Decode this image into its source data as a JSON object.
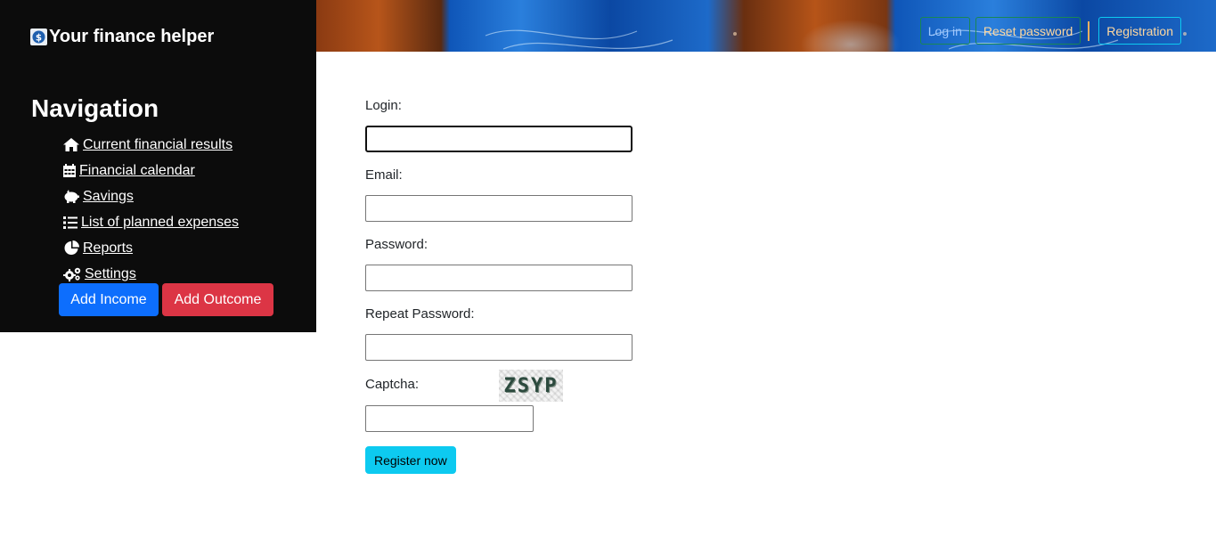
{
  "brand": {
    "title": "Your finance helper",
    "logo_icon": "dollar-coin-icon"
  },
  "sidebar": {
    "heading": "Navigation",
    "items": [
      {
        "label": " Current financial results",
        "icon": "home-icon"
      },
      {
        "label": " Financial calendar",
        "icon": "calendar-icon"
      },
      {
        "label": " Savings",
        "icon": "piggy-bank-icon"
      },
      {
        "label": " List of planned expenses",
        "icon": "list-icon"
      },
      {
        "label": " Reports",
        "icon": "pie-chart-icon"
      },
      {
        "label": " Settings",
        "icon": "gears-icon"
      }
    ],
    "add_income_label": "Add Income",
    "add_outcome_label": "Add Outcome"
  },
  "header": {
    "login_label": "Log in",
    "reset_label": "Reset password",
    "registration_label": "Registration"
  },
  "form": {
    "login_label": "Login:",
    "login_value": "",
    "email_label": "Email:",
    "email_value": "",
    "password_label": "Password:",
    "password_value": "",
    "repeat_password_label": "Repeat Password:",
    "repeat_password_value": "",
    "captcha_label": "Captcha:",
    "captcha_text": "ZSYP",
    "captcha_value": "",
    "submit_label": "Register now"
  },
  "colors": {
    "sidebar_bg": "#0c0c0c",
    "income": "#0d6efd",
    "outcome": "#dc3545",
    "register": "#0dcaf0"
  }
}
